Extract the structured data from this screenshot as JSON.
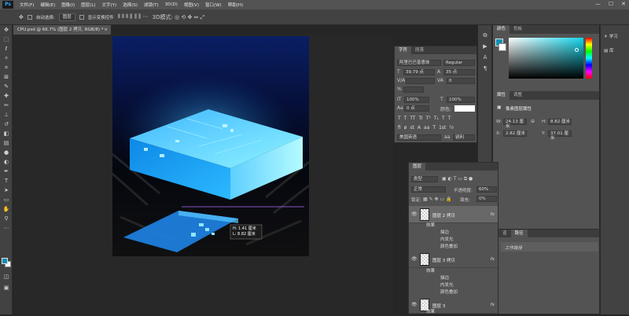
{
  "app": {
    "logo_text": "Ps"
  },
  "menu": [
    "文件(F)",
    "编辑(E)",
    "图像(I)",
    "图层(L)",
    "文字(Y)",
    "选择(S)",
    "滤镜(T)",
    "3D(D)",
    "视图(V)",
    "窗口(W)",
    "帮助(H)"
  ],
  "options_bar": {
    "auto_select_label": "自动选择:",
    "auto_select_value": "图层",
    "transform_label": "显示变换控件"
  },
  "document": {
    "tab_title": "CPU.psd @ 66.7% (图层 2 拷贝, RGB/8) *",
    "close": "×"
  },
  "tooltip": {
    "h_label": "H: 1.41 厘米",
    "w_label": "L: 8.82 厘米"
  },
  "character_panel": {
    "tabs": [
      "字符",
      "段落"
    ],
    "font_family": "阿里巴巴普惠体",
    "font_style": "Regular",
    "font_size": "39.79 点",
    "leading": "35 点",
    "kerning": "",
    "tracking": "0",
    "vertical_scale": "100%",
    "horizontal_scale": "100%",
    "baseline_shift": "0 点",
    "color_label": "颜色:",
    "language": "美国英语",
    "aa_label": "aa",
    "aa_value": "锐利",
    "format_buttons": [
      "T",
      "T",
      "TT",
      "Tr",
      "T¹",
      "T₁",
      "T",
      "T"
    ],
    "extra_buttons": [
      "fi",
      "ø",
      "st",
      "A",
      "aa",
      "T",
      "1st",
      "½"
    ]
  },
  "color_panel": {
    "tabs": [
      "颜色",
      "色板"
    ],
    "fg": "#0d8fb5"
  },
  "properties_panel": {
    "tabs": [
      "属性",
      "调整"
    ],
    "kind": "像素图层属性",
    "w_label": "W:",
    "w": "24.13 厘米",
    "h_label": "H:",
    "h": "8.82 厘米",
    "x_label": "X:",
    "x": "2.82 厘米",
    "y_label": "Y:",
    "y": "37.01 厘米"
  },
  "far_right": [
    {
      "label": "学习"
    },
    {
      "label": "库"
    }
  ],
  "layers_panel": {
    "tab": "图层",
    "filter_kind": "类型",
    "blend_mode": "正常",
    "opacity_label": "不透明度:",
    "opacity": "60%",
    "lock_label": "锁定:",
    "fill_label": "填充:",
    "fill": "0%",
    "layers": [
      {
        "name": "图层 2 拷贝",
        "fx": "fx",
        "effects_label": "效果",
        "effects": [
          "描边",
          "内发光",
          "颜色叠加"
        ]
      },
      {
        "name": "图层 3 拷贝",
        "fx": "fx",
        "effects_label": "效果",
        "effects": [
          "描边",
          "内发光",
          "颜色叠加"
        ]
      },
      {
        "name": "图层 3",
        "fx": "fx",
        "effects_label": "效果",
        "effects": []
      }
    ]
  },
  "paths_panel": {
    "tabs": [
      "道",
      "路径"
    ],
    "item": "工作路径"
  }
}
